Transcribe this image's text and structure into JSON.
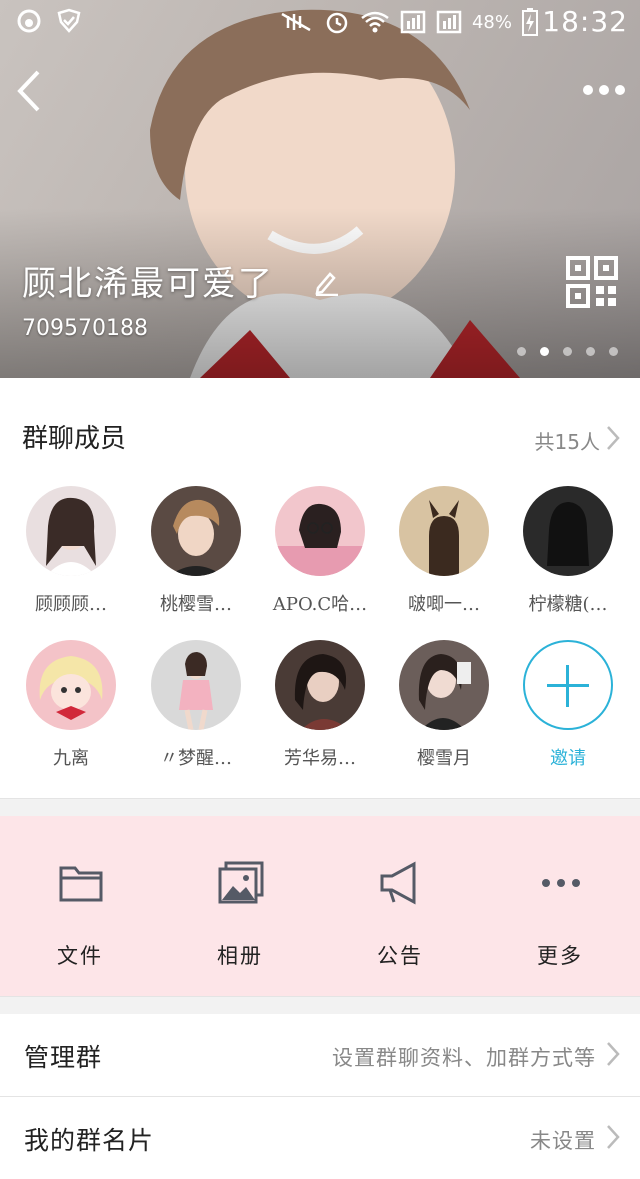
{
  "status_bar": {
    "battery": "48%",
    "time": "18:32"
  },
  "group": {
    "name": "顾北浠最可爱了",
    "id": "709570188"
  },
  "members_section": {
    "title": "群聊成员",
    "count": "共15人",
    "members": [
      {
        "name": "顾顾顾…",
        "color": "#e9dfe0"
      },
      {
        "name": "桃樱雪…",
        "color": "#5a4a43"
      },
      {
        "name": "APO.C哈…",
        "color": "#f2c6cc"
      },
      {
        "name": "啵唧一…",
        "color": "#d8c3a2"
      },
      {
        "name": "柠檬糖(…",
        "color": "#2a2a2a"
      },
      {
        "name": "九离",
        "color": "#f4c3c8"
      },
      {
        "name": "〃梦醒…",
        "color": "#d9d9d9"
      },
      {
        "name": "芳华易…",
        "color": "#4a3b36"
      },
      {
        "name": "樱雪月",
        "color": "#6b5e5a"
      }
    ],
    "invite_label": "邀请"
  },
  "tools": [
    {
      "label": "文件",
      "icon": "folder-icon"
    },
    {
      "label": "相册",
      "icon": "album-icon"
    },
    {
      "label": "公告",
      "icon": "announcement-icon"
    },
    {
      "label": "更多",
      "icon": "more-dots-icon"
    }
  ],
  "rows": [
    {
      "label": "管理群",
      "value": "设置群聊资料、加群方式等"
    },
    {
      "label": "我的群名片",
      "value": "未设置"
    }
  ],
  "colors": {
    "accent": "#2bb2d8",
    "tools_bg": "#fde5e8"
  }
}
